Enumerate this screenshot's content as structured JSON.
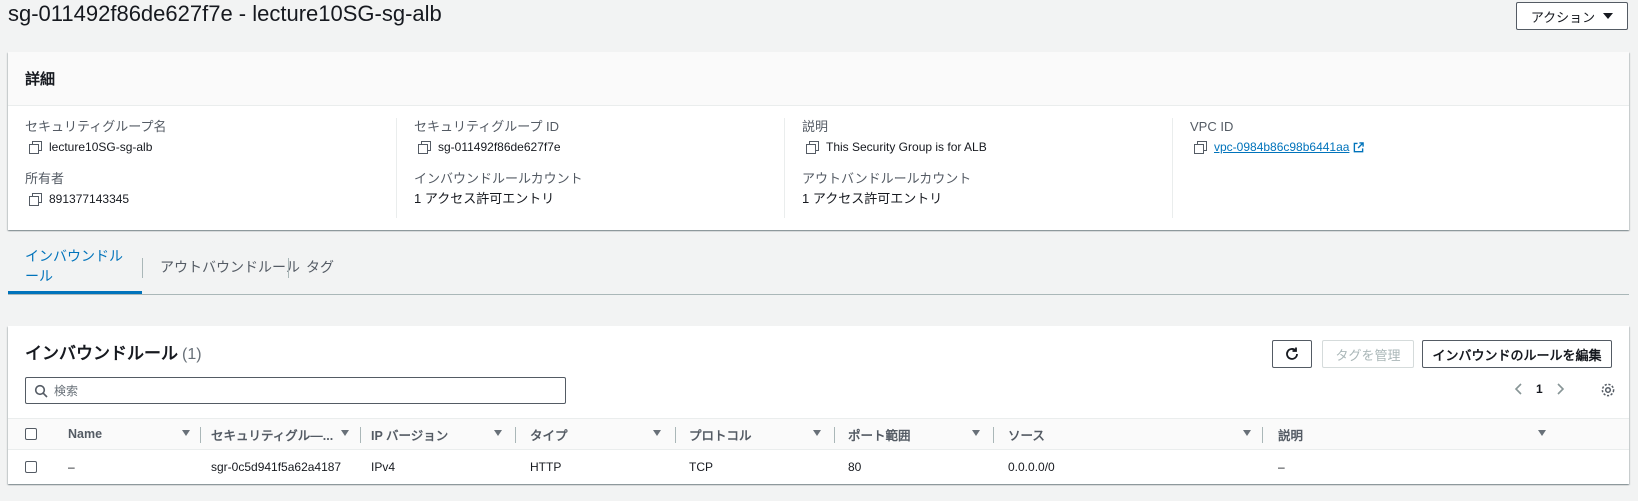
{
  "header": {
    "title": "sg-011492f86de627f7e - lecture10SG-sg-alb",
    "actions_label": "アクション"
  },
  "details": {
    "title": "詳細",
    "fields": {
      "sg_name": {
        "label": "セキュリティグループ名",
        "value": "lecture10SG-sg-alb"
      },
      "sg_id": {
        "label": "セキュリティグループ ID",
        "value": "sg-011492f86de627f7e"
      },
      "description": {
        "label": "説明",
        "value": "This Security Group is for ALB"
      },
      "vpc_id": {
        "label": "VPC ID",
        "value": "vpc-0984b86c98b6441aa"
      },
      "owner": {
        "label": "所有者",
        "value": "891377143345"
      },
      "inbound_count": {
        "label": "インバウンドルールカウント",
        "value": "1 アクセス許可エントリ"
      },
      "outbound_count": {
        "label": "アウトバンドルールカウント",
        "value": "1 アクセス許可エントリ"
      }
    }
  },
  "tabs": [
    {
      "label": "インバウンドルール",
      "active": true
    },
    {
      "label": "アウトバウンドルール",
      "active": false
    },
    {
      "label": "タグ",
      "active": false
    }
  ],
  "rules": {
    "title": "インバウンドルール",
    "count": "(1)",
    "manage_tags_label": "タグを管理",
    "edit_rules_label": "インバウンドのルールを編集",
    "search_placeholder": "検索",
    "page_number": "1",
    "columns": [
      "Name",
      "セキュリティグル―...",
      "IP バージョン",
      "タイプ",
      "プロトコル",
      "ポート範囲",
      "ソース",
      "説明"
    ],
    "rows": [
      {
        "name": "–",
        "sgr": "sgr-0c5d941f5a62a4187",
        "ip_version": "IPv4",
        "type": "HTTP",
        "protocol": "TCP",
        "port_range": "80",
        "source": "0.0.0.0/0",
        "description": "–"
      }
    ]
  },
  "colors": {
    "link": "#0073bb",
    "background": "#f2f3f3",
    "border": "#545b64"
  }
}
